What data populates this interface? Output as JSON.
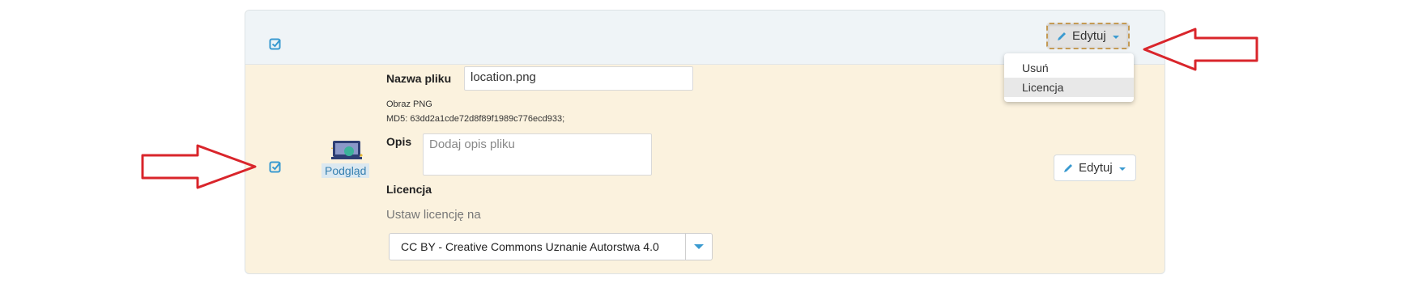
{
  "header": {
    "edit_label": "Edytuj"
  },
  "dropdown": {
    "items": [
      {
        "label": "Usuń"
      },
      {
        "label": "Licencja"
      }
    ]
  },
  "file": {
    "preview_label": "Podgląd",
    "name_label": "Nazwa pliku",
    "name_value": "location.png",
    "type": "Obraz PNG",
    "md5": "MD5: 63dd2a1cde72d8f89f1989c776ecd933;",
    "description_label": "Opis",
    "description_placeholder": "Dodaj opis pliku",
    "license_label": "Licencja",
    "license_hint": "Ustaw licencję na",
    "license_value": "CC BY - Creative Commons Uznanie Autorstwa 4.0",
    "edit_label": "Edytuj"
  },
  "colors": {
    "accent": "#3a9ad0",
    "annotation_arrow": "#d9252b",
    "row_background": "#fbf2de",
    "header_background": "#eff4f7"
  },
  "icons": [
    "checkbox-checked-icon",
    "pencil-icon",
    "caret-down-icon",
    "image-thumbnail-icon"
  ]
}
